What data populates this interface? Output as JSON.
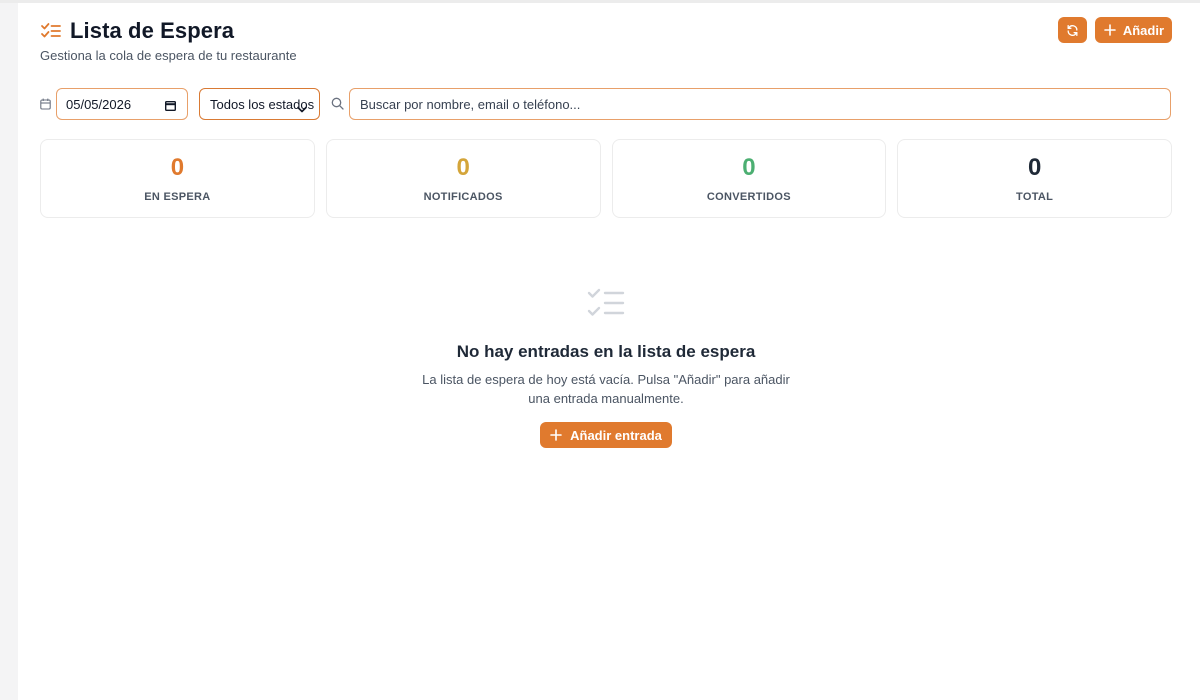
{
  "header": {
    "title": "Lista de Espera",
    "subtitle": "Gestiona la cola de espera de tu restaurante",
    "title_icon": "list-checks-icon",
    "refresh_icon": "refresh-icon",
    "add_label": "Añadir",
    "add_icon": "plus-icon"
  },
  "filters": {
    "date_icon": "calendar-icon",
    "date_value": "05/05/2026",
    "status_value": "Todos los estados",
    "search_icon": "search-icon",
    "search_placeholder": "Buscar por nombre, email o teléfono..."
  },
  "stats": [
    {
      "value": "0",
      "label": "EN ESPERA",
      "color": "#e07a2e"
    },
    {
      "value": "0",
      "label": "NOTIFICADOS",
      "color": "#d4a53a"
    },
    {
      "value": "0",
      "label": "CONVERTIDOS",
      "color": "#4caf72"
    },
    {
      "value": "0",
      "label": "TOTAL",
      "color": "#1f2937"
    }
  ],
  "empty_state": {
    "icon": "list-checks-icon",
    "title": "No hay entradas en la lista de espera",
    "description": "La lista de espera de hoy está vacía. Pulsa \"Añadir\" para añadir una entrada manualmente.",
    "button_label": "Añadir entrada"
  },
  "colors": {
    "accent": "#e07a2e"
  }
}
